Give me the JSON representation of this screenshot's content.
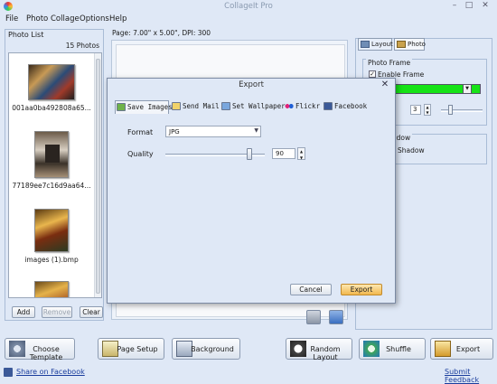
{
  "app": {
    "title": "CollageIt Pro"
  },
  "window_controls": {
    "minimize": "–",
    "maximize": "□",
    "close": "✕"
  },
  "menu": [
    "File",
    "Photo",
    "Collage",
    "Options",
    "Help"
  ],
  "photo_list": {
    "title": "Photo List",
    "count": "15 Photos",
    "items": [
      {
        "label": "001aa0ba492808a65..."
      },
      {
        "label": "77189ee7c16d9aa64..."
      },
      {
        "label": "images (1).bmp"
      },
      {
        "label": ""
      }
    ],
    "buttons": {
      "add": "Add",
      "remove": "Remove",
      "clear": "Clear"
    }
  },
  "page_info": "Page:  7.00\" x 5.00\", DPI: 300",
  "right_panel": {
    "tabs": [
      "Layout",
      "Photo"
    ],
    "photo_frame": {
      "title": "Photo Frame",
      "enable_label": "Enable Frame",
      "width_value": "3",
      "color": "#16e316"
    },
    "shadow": {
      "title": "adow",
      "label": "Shadow"
    }
  },
  "toolbar": {
    "choose_template": "Choose Template",
    "page_setup": "Page Setup",
    "background": "Background",
    "random_layout": "Random Layout",
    "shuffle": "Shuffle",
    "export": "Export"
  },
  "links": {
    "share": "Share on Facebook",
    "feedback": "Submit Feedback"
  },
  "dialog": {
    "title": "Export",
    "close": "✕",
    "tabs": [
      "Save Images",
      "Send Mail",
      "Set Wallpaper",
      "Flickr",
      "Facebook"
    ],
    "format_label": "Format",
    "format_value": "JPG",
    "quality_label": "Quality",
    "quality_value": "90",
    "quality_level": 0.9,
    "cancel": "Cancel",
    "export": "Export"
  },
  "colors": {
    "accent": "#dfe8f6",
    "export_button": "#f7c56b",
    "link": "#1a3d9d"
  }
}
